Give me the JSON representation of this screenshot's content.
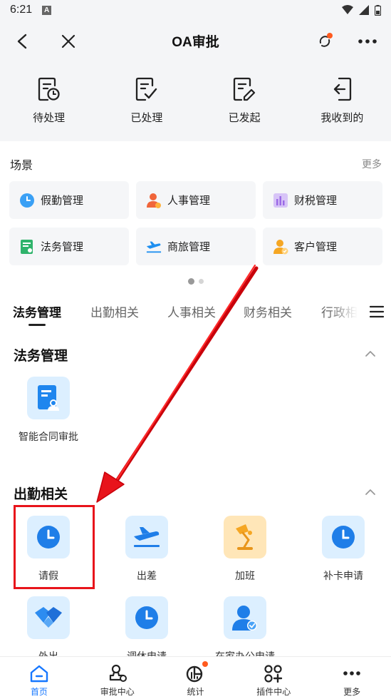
{
  "status_bar": {
    "time": "6:21",
    "notif_letter": "A"
  },
  "header": {
    "title": "OA审批"
  },
  "quick_actions": [
    {
      "label": "待处理",
      "icon": "pending-doc-icon"
    },
    {
      "label": "已处理",
      "icon": "processed-doc-icon"
    },
    {
      "label": "已发起",
      "icon": "initiated-doc-icon"
    },
    {
      "label": "我收到的",
      "icon": "received-doc-icon"
    }
  ],
  "scene": {
    "title": "场景",
    "more": "更多",
    "items": [
      {
        "label": "假勤管理",
        "icon": "clock-icon"
      },
      {
        "label": "人事管理",
        "icon": "person-icon"
      },
      {
        "label": "财税管理",
        "icon": "chart-icon"
      },
      {
        "label": "法务管理",
        "icon": "legal-doc-icon"
      },
      {
        "label": "商旅管理",
        "icon": "plane-icon"
      },
      {
        "label": "客户管理",
        "icon": "customer-icon"
      }
    ]
  },
  "tabs": [
    "法务管理",
    "出勤相关",
    "人事相关",
    "财务相关",
    "行政相"
  ],
  "sections": {
    "legal": {
      "title": "法务管理",
      "apps": [
        {
          "label": "智能合同审批"
        }
      ]
    },
    "attendance": {
      "title": "出勤相关",
      "apps": [
        {
          "label": "请假"
        },
        {
          "label": "出差"
        },
        {
          "label": "加班"
        },
        {
          "label": "补卡申请"
        },
        {
          "label": "外出"
        },
        {
          "label": "调休申请"
        },
        {
          "label": "在家办公申请"
        }
      ]
    }
  },
  "bottom_nav": [
    "首页",
    "审批中心",
    "统计",
    "插件中心",
    "更多"
  ],
  "colors": {
    "accent": "#1677ff",
    "highlight": "#e8141b",
    "badge": "#ff5a1f"
  }
}
